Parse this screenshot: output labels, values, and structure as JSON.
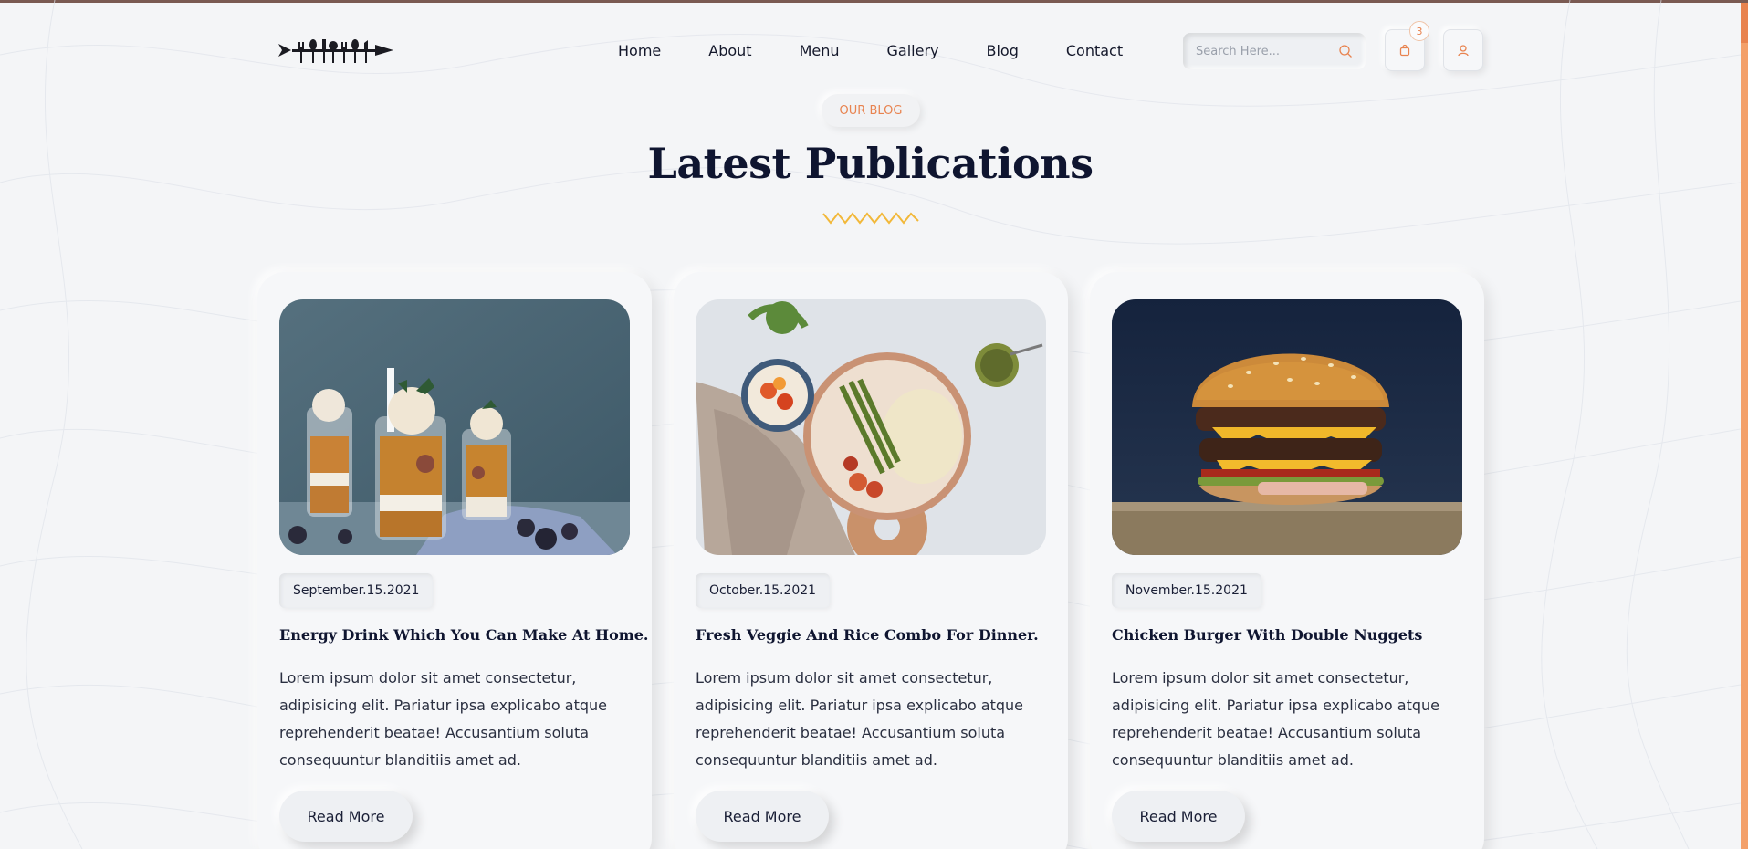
{
  "nav": {
    "links": [
      "Home",
      "About",
      "Menu",
      "Gallery",
      "Blog",
      "Contact"
    ],
    "search_placeholder": "Search Here...",
    "cart_count": "3"
  },
  "section": {
    "eyebrow": "OUR BLOG",
    "title": "Latest Publications"
  },
  "posts": [
    {
      "date": "September.15.2021",
      "title": "Energy Drink Which You Can Make At Home.",
      "text": "Lorem ipsum dolor sit amet consectetur, adipisicing elit. Pariatur ipsa explicabo atque reprehenderit beatae! Accusantium soluta consequuntur blanditiis amet ad.",
      "button": "Read More",
      "image": "energy-drink-photo"
    },
    {
      "date": "October.15.2021",
      "title": "Fresh Veggie And Rice Combo For Dinner.",
      "text": "Lorem ipsum dolor sit amet consectetur, adipisicing elit. Pariatur ipsa explicabo atque reprehenderit beatae! Accusantium soluta consequuntur blanditiis amet ad.",
      "button": "Read More",
      "image": "veggie-rice-photo"
    },
    {
      "date": "November.15.2021",
      "title": "Chicken Burger With Double Nuggets",
      "text": "Lorem ipsum dolor sit amet consectetur, adipisicing elit. Pariatur ipsa explicabo atque reprehenderit beatae! Accusantium soluta consequuntur blanditiis amet ad.",
      "button": "Read More",
      "image": "burger-photo"
    }
  ],
  "colors": {
    "accent": "#e8834f",
    "title": "#0f1530",
    "zigzag": "#f2b83a",
    "background": "#f4f5f7"
  }
}
